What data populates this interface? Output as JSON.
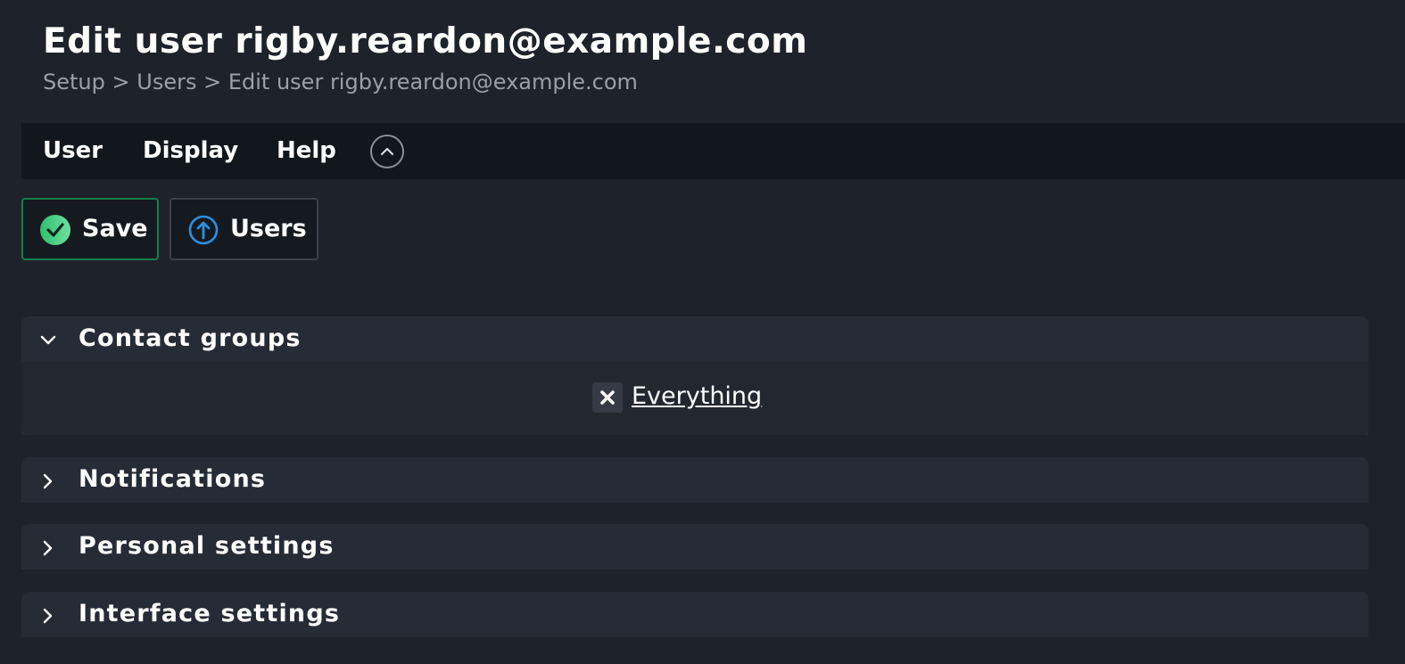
{
  "page": {
    "title": "Edit user rigby.reardon@example.com",
    "breadcrumb": [
      "Setup",
      "Users",
      "Edit user rigby.reardon@example.com"
    ],
    "breadcrumb_separator": ">"
  },
  "menu": {
    "items": [
      "User",
      "Display",
      "Help"
    ],
    "collapse_icon": "chevron-up-circle-icon"
  },
  "toolbar": {
    "save_label": "Save",
    "save_icon": "checkmark-circle-icon",
    "users_label": "Users",
    "users_icon": "arrow-up-circle-icon"
  },
  "sections": [
    {
      "title": "Contact groups",
      "expanded": true,
      "groups": [
        "Everything"
      ]
    },
    {
      "title": "Notifications",
      "expanded": false
    },
    {
      "title": "Personal settings",
      "expanded": false
    },
    {
      "title": "Interface settings",
      "expanded": false
    }
  ],
  "colors": {
    "background": "#1e222a",
    "menubar": "#12161d",
    "section_header": "#262c36",
    "save_accent": "#14804e",
    "users_icon": "#2f8ee0",
    "save_icon": "#3ccf7c"
  }
}
